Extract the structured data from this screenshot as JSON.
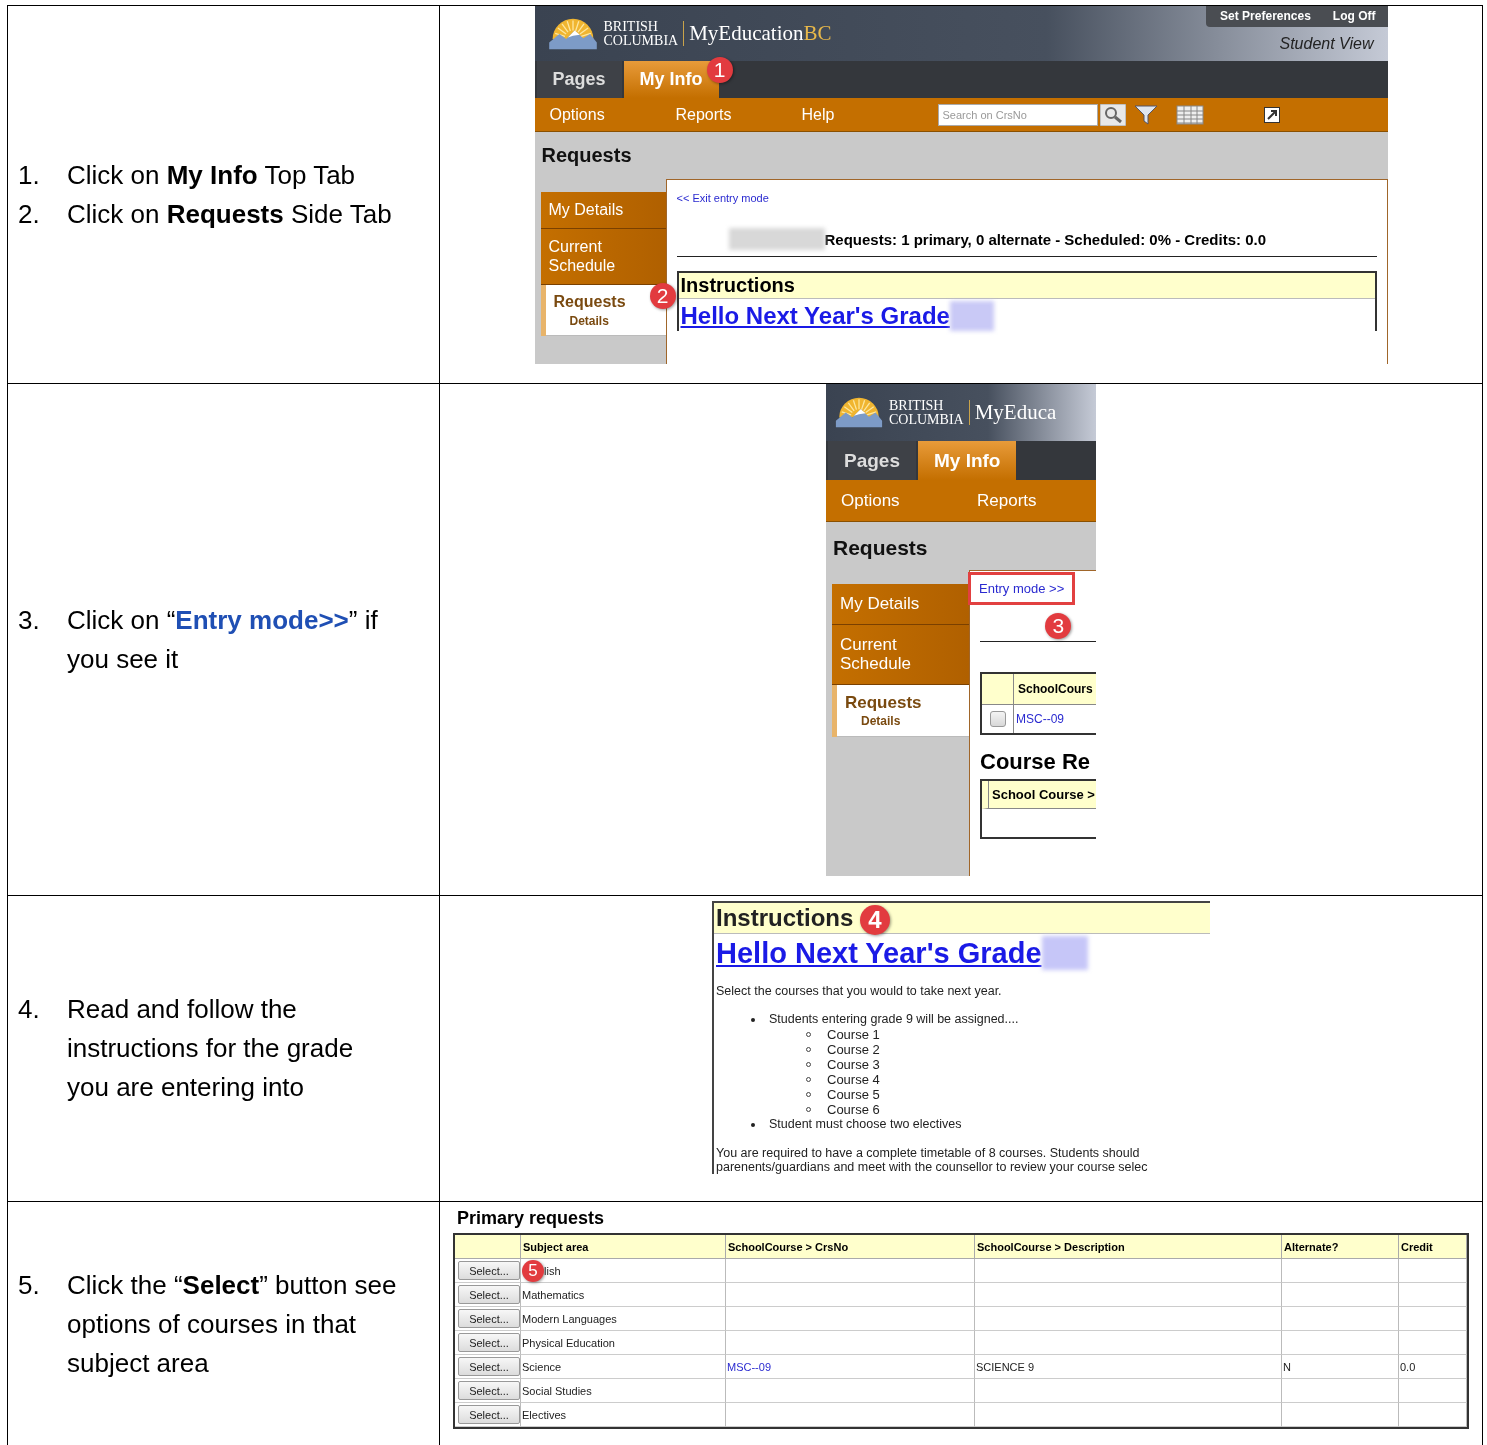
{
  "rows": [
    {
      "steps": [
        {
          "number": "1.",
          "text": "Click on **My Info** Top Tab"
        },
        {
          "number": "2.",
          "text": "Click on **Requests** Side Tab"
        }
      ],
      "screenshot": {
        "kind": "portal",
        "logo": {
          "line1": "BRITISH",
          "line2": "COLUMBIA",
          "brand": "MyEducation",
          "brand_accent": "BC"
        },
        "header_links": [
          "Set Preferences",
          "Log Off"
        ],
        "view_label": "Student View",
        "tabs": [
          {
            "label": "Pages",
            "selected": false
          },
          {
            "label": "My Info",
            "selected": true,
            "callout": "1"
          }
        ],
        "menu": [
          "Options",
          "Reports",
          "Help"
        ],
        "search": {
          "placeholder": "Search on CrsNo"
        },
        "page_title": "Requests",
        "side_tabs": [
          {
            "label": "My Details",
            "selected": false
          },
          {
            "label": "Current Schedule",
            "selected": false
          },
          {
            "label": "Requests",
            "sub": "Details",
            "selected": true,
            "callout": "2"
          }
        ],
        "mode_link": {
          "label": "<< Exit entry mode",
          "highlighted": false
        },
        "summary": "Requests: 1 primary, 0 alternate - Scheduled: 0% - Credits: 0.0",
        "instructions": {
          "title": "Instructions",
          "heading": "Hello Next Year's Grade"
        }
      }
    },
    {
      "steps": [
        {
          "kind": "link",
          "number": "3.",
          "text": "Click on “**Entry mode>>**” if you see it"
        }
      ],
      "screenshot": {
        "kind": "portal",
        "logo": {
          "line1": "BRITISH",
          "line2": "COLUMBIA",
          "brand": "MyEduca"
        },
        "tabs": [
          {
            "label": "Pages",
            "selected": false
          },
          {
            "label": "My Info",
            "selected": true
          }
        ],
        "menu": [
          "Options",
          "Reports"
        ],
        "page_title": "Requests",
        "side_tabs": [
          {
            "label": "My Details",
            "selected": false
          },
          {
            "label": "Current Schedule",
            "selected": false
          },
          {
            "label": "Requests",
            "sub": "Details",
            "selected": true
          }
        ],
        "mode_link": {
          "label": "Entry mode >>",
          "highlighted": true,
          "callout": "3"
        },
        "course_table": {
          "column": "SchoolCours",
          "rows": [
            {
              "checked": false,
              "value": "MSC--09"
            }
          ]
        },
        "section": {
          "title": "Course Re",
          "column": "School Course >"
        }
      }
    },
    {
      "steps": [
        {
          "number": "4.",
          "text": "Read and follow the instructions for the grade you are entering into"
        }
      ],
      "screenshot": {
        "kind": "instructions",
        "title": "Instructions",
        "callout": "4",
        "heading": "Hello Next Year's Grade",
        "intro": "Select the courses that you would to take next year.",
        "bullets": [
          {
            "text": "Students entering grade 9 will be assigned....",
            "children": [
              {
                "text": "Course 1"
              },
              {
                "text": "Course 2"
              },
              {
                "text": "Course 3"
              },
              {
                "text": "Course 4"
              },
              {
                "text": "Course 5"
              },
              {
                "text": "Course 6"
              }
            ]
          },
          {
            "text": "Student must choose two electives"
          }
        ],
        "outro": [
          "You are required to have a complete timetable of 8 courses.  Students should",
          "parenents/guardians and meet with the counsellor to review your course selec"
        ]
      }
    },
    {
      "steps": [
        {
          "number": "5.",
          "text": "Click the “**Select**” button see options of courses in that subject area"
        }
      ],
      "screenshot": {
        "kind": "requests_table",
        "title": "Primary requests",
        "columns": [
          "Subject area",
          "SchoolCourse > CrsNo",
          "SchoolCourse > Description",
          "Alternate?",
          "Credit"
        ],
        "rows": [
          {
            "action": "Select...",
            "callout": "5",
            "subject": "lish"
          },
          {
            "action": "Select...",
            "subject": "Mathematics"
          },
          {
            "action": "Select...",
            "subject": "Modern Languages"
          },
          {
            "action": "Select...",
            "subject": "Physical Education"
          },
          {
            "action": "Select...",
            "subject": "Science",
            "crsno": "MSC--09",
            "description": "SCIENCE 9",
            "alternate": "N",
            "credit": "0.0"
          },
          {
            "action": "Select...",
            "subject": "Social Studies"
          },
          {
            "action": "Select...",
            "subject": "Electives"
          }
        ]
      }
    }
  ]
}
